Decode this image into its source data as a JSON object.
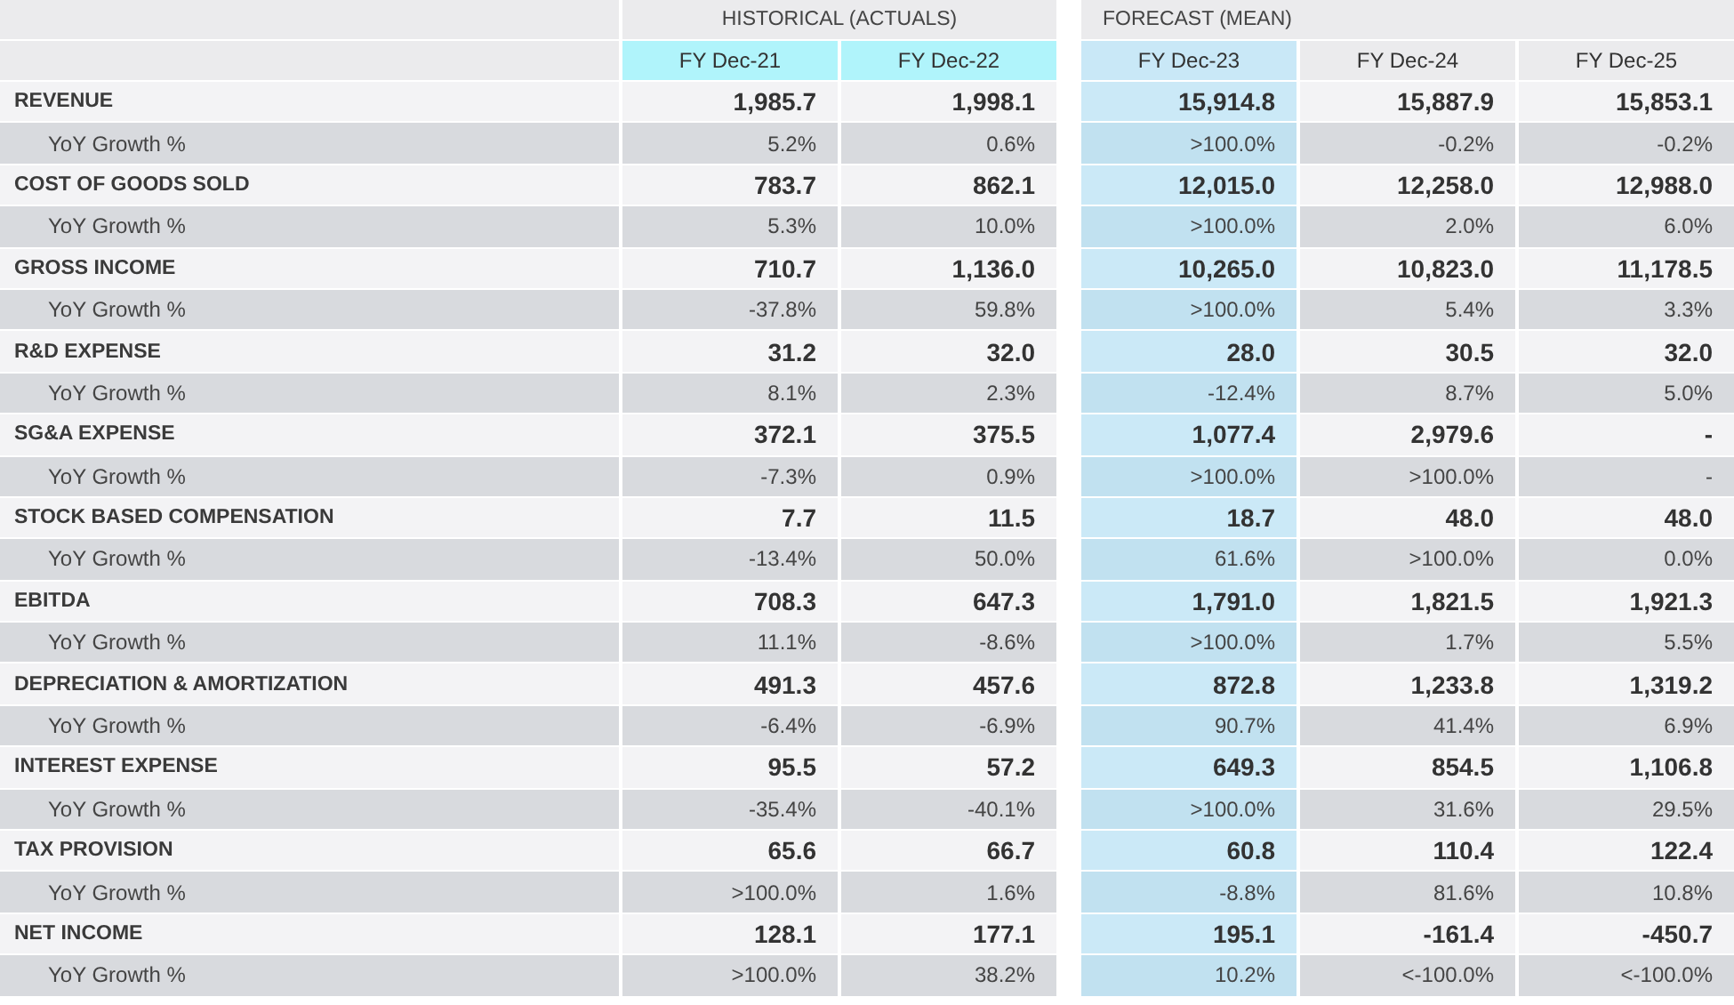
{
  "groups": [
    {
      "label": "HISTORICAL (ACTUALS)",
      "kind": "historical",
      "columns": [
        {
          "label": "FY Dec-21",
          "selected": false
        },
        {
          "label": "FY Dec-22",
          "selected": false
        }
      ]
    },
    {
      "label": "FORECAST (MEAN)",
      "kind": "forecast",
      "columns": [
        {
          "label": "FY Dec-23",
          "selected": true
        },
        {
          "label": "FY Dec-24",
          "selected": false
        },
        {
          "label": "FY Dec-25",
          "selected": false
        }
      ]
    }
  ],
  "rows": [
    {
      "label": "REVENUE",
      "kind": "main",
      "values": [
        "1,985.7",
        "1,998.1",
        "15,914.8",
        "15,887.9",
        "15,853.1"
      ]
    },
    {
      "label": "YoY Growth %",
      "kind": "growth",
      "values": [
        "5.2%",
        "0.6%",
        ">100.0%",
        "-0.2%",
        "-0.2%"
      ]
    },
    {
      "label": "COST OF GOODS SOLD",
      "kind": "main",
      "values": [
        "783.7",
        "862.1",
        "12,015.0",
        "12,258.0",
        "12,988.0"
      ]
    },
    {
      "label": "YoY Growth %",
      "kind": "growth",
      "values": [
        "5.3%",
        "10.0%",
        ">100.0%",
        "2.0%",
        "6.0%"
      ]
    },
    {
      "label": "GROSS INCOME",
      "kind": "main",
      "values": [
        "710.7",
        "1,136.0",
        "10,265.0",
        "10,823.0",
        "11,178.5"
      ]
    },
    {
      "label": "YoY Growth %",
      "kind": "growth",
      "values": [
        "-37.8%",
        "59.8%",
        ">100.0%",
        "5.4%",
        "3.3%"
      ]
    },
    {
      "label": "R&D EXPENSE",
      "kind": "main",
      "values": [
        "31.2",
        "32.0",
        "28.0",
        "30.5",
        "32.0"
      ]
    },
    {
      "label": "YoY Growth %",
      "kind": "growth",
      "values": [
        "8.1%",
        "2.3%",
        "-12.4%",
        "8.7%",
        "5.0%"
      ]
    },
    {
      "label": "SG&A EXPENSE",
      "kind": "main",
      "values": [
        "372.1",
        "375.5",
        "1,077.4",
        "2,979.6",
        "-"
      ]
    },
    {
      "label": "YoY Growth %",
      "kind": "growth",
      "values": [
        "-7.3%",
        "0.9%",
        ">100.0%",
        ">100.0%",
        "-"
      ]
    },
    {
      "label": "STOCK BASED COMPENSATION",
      "kind": "main",
      "values": [
        "7.7",
        "11.5",
        "18.7",
        "48.0",
        "48.0"
      ]
    },
    {
      "label": "YoY Growth %",
      "kind": "growth",
      "values": [
        "-13.4%",
        "50.0%",
        "61.6%",
        ">100.0%",
        "0.0%"
      ]
    },
    {
      "label": "EBITDA",
      "kind": "main",
      "values": [
        "708.3",
        "647.3",
        "1,791.0",
        "1,821.5",
        "1,921.3"
      ]
    },
    {
      "label": "YoY Growth %",
      "kind": "growth",
      "values": [
        "11.1%",
        "-8.6%",
        ">100.0%",
        "1.7%",
        "5.5%"
      ]
    },
    {
      "label": "DEPRECIATION & AMORTIZATION",
      "kind": "main",
      "values": [
        "491.3",
        "457.6",
        "872.8",
        "1,233.8",
        "1,319.2"
      ]
    },
    {
      "label": "YoY Growth %",
      "kind": "growth",
      "values": [
        "-6.4%",
        "-6.9%",
        "90.7%",
        "41.4%",
        "6.9%"
      ]
    },
    {
      "label": "INTEREST EXPENSE",
      "kind": "main",
      "values": [
        "95.5",
        "57.2",
        "649.3",
        "854.5",
        "1,106.8"
      ]
    },
    {
      "label": "YoY Growth %",
      "kind": "growth",
      "values": [
        "-35.4%",
        "-40.1%",
        ">100.0%",
        "31.6%",
        "29.5%"
      ]
    },
    {
      "label": "TAX PROVISION",
      "kind": "main",
      "values": [
        "65.6",
        "66.7",
        "60.8",
        "110.4",
        "122.4"
      ]
    },
    {
      "label": "YoY Growth %",
      "kind": "growth",
      "values": [
        ">100.0%",
        "1.6%",
        "-8.8%",
        "81.6%",
        "10.8%"
      ]
    },
    {
      "label": "NET INCOME",
      "kind": "main",
      "values": [
        "128.1",
        "177.1",
        "195.1",
        "-161.4",
        "-450.7"
      ]
    },
    {
      "label": "YoY Growth %",
      "kind": "growth",
      "values": [
        ">100.0%",
        "38.2%",
        "10.2%",
        "<-100.0%",
        "<-100.0%"
      ]
    }
  ]
}
